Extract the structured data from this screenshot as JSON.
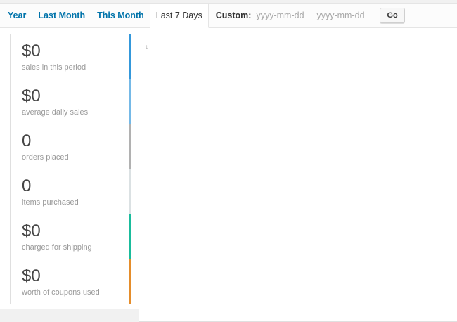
{
  "range_tabs": [
    {
      "label": "Year",
      "active": false
    },
    {
      "label": "Last Month",
      "active": false
    },
    {
      "label": "This Month",
      "active": false
    },
    {
      "label": "Last 7 Days",
      "active": true
    }
  ],
  "custom_range": {
    "label": "Custom:",
    "from_placeholder": "yyyy-mm-dd",
    "to_placeholder": "yyyy-mm-dd",
    "go_label": "Go"
  },
  "legend": [
    {
      "value": "$0",
      "description": "sales in this period",
      "color": "#3498db"
    },
    {
      "value": "$0",
      "description": "average daily sales",
      "color": "#75b9e7"
    },
    {
      "value": "0",
      "description": "orders placed",
      "color": "#b1b1b1"
    },
    {
      "value": "0",
      "description": "items purchased",
      "color": "#dbe1e3"
    },
    {
      "value": "$0",
      "description": "charged for shipping",
      "color": "#1abc9c"
    },
    {
      "value": "$0",
      "description": "worth of coupons used",
      "color": "#e58d2b"
    }
  ],
  "chart_data": {
    "type": "line",
    "y_ticks": [
      "1"
    ],
    "series": []
  }
}
